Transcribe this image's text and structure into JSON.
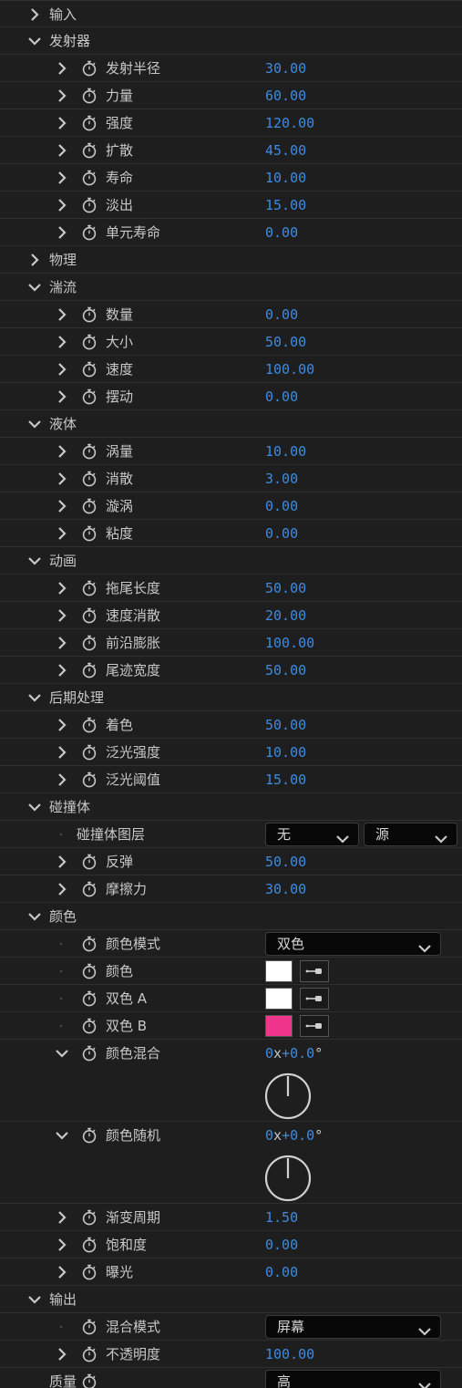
{
  "rows": [
    {
      "type": "group",
      "level": 0,
      "expanded": false,
      "label": "输入"
    },
    {
      "type": "group",
      "level": 0,
      "expanded": true,
      "label": "发射器"
    },
    {
      "type": "value",
      "level": 1,
      "twisty": true,
      "watch": true,
      "label": "发射半径",
      "value": "30.00"
    },
    {
      "type": "value",
      "level": 1,
      "twisty": true,
      "watch": true,
      "label": "力量",
      "value": "60.00"
    },
    {
      "type": "value",
      "level": 1,
      "twisty": true,
      "watch": true,
      "label": "强度",
      "value": "120.00"
    },
    {
      "type": "value",
      "level": 1,
      "twisty": true,
      "watch": true,
      "label": "扩散",
      "value": "45.00"
    },
    {
      "type": "value",
      "level": 1,
      "twisty": true,
      "watch": true,
      "label": "寿命",
      "value": "10.00"
    },
    {
      "type": "value",
      "level": 1,
      "twisty": true,
      "watch": true,
      "label": "淡出",
      "value": "15.00"
    },
    {
      "type": "value",
      "level": 1,
      "twisty": true,
      "watch": true,
      "label": "单元寿命",
      "value": "0.00"
    },
    {
      "type": "group",
      "level": 0,
      "expanded": false,
      "label": "物理"
    },
    {
      "type": "group",
      "level": 0,
      "expanded": true,
      "label": "湍流"
    },
    {
      "type": "value",
      "level": 1,
      "twisty": true,
      "watch": true,
      "label": "数量",
      "value": "0.00"
    },
    {
      "type": "value",
      "level": 1,
      "twisty": true,
      "watch": true,
      "label": "大小",
      "value": "50.00"
    },
    {
      "type": "value",
      "level": 1,
      "twisty": true,
      "watch": true,
      "label": "速度",
      "value": "100.00"
    },
    {
      "type": "value",
      "level": 1,
      "twisty": true,
      "watch": true,
      "label": "摆动",
      "value": "0.00"
    },
    {
      "type": "group",
      "level": 0,
      "expanded": true,
      "label": "液体"
    },
    {
      "type": "value",
      "level": 1,
      "twisty": true,
      "watch": true,
      "label": "涡量",
      "value": "10.00"
    },
    {
      "type": "value",
      "level": 1,
      "twisty": true,
      "watch": true,
      "label": "消散",
      "value": "3.00"
    },
    {
      "type": "value",
      "level": 1,
      "twisty": true,
      "watch": true,
      "label": "漩涡",
      "value": "0.00"
    },
    {
      "type": "value",
      "level": 1,
      "twisty": true,
      "watch": true,
      "label": "粘度",
      "value": "0.00"
    },
    {
      "type": "group",
      "level": 0,
      "expanded": true,
      "label": "动画"
    },
    {
      "type": "value",
      "level": 1,
      "twisty": true,
      "watch": true,
      "label": "拖尾长度",
      "value": "50.00"
    },
    {
      "type": "value",
      "level": 1,
      "twisty": true,
      "watch": true,
      "label": "速度消散",
      "value": "20.00"
    },
    {
      "type": "value",
      "level": 1,
      "twisty": true,
      "watch": true,
      "label": "前沿膨胀",
      "value": "100.00"
    },
    {
      "type": "value",
      "level": 1,
      "twisty": true,
      "watch": true,
      "label": "尾迹宽度",
      "value": "50.00"
    },
    {
      "type": "group",
      "level": 0,
      "expanded": true,
      "label": "后期处理"
    },
    {
      "type": "value",
      "level": 1,
      "twisty": true,
      "watch": true,
      "label": "着色",
      "value": "50.00"
    },
    {
      "type": "value",
      "level": 1,
      "twisty": true,
      "watch": true,
      "label": "泛光强度",
      "value": "10.00"
    },
    {
      "type": "value",
      "level": 1,
      "twisty": true,
      "watch": true,
      "label": "泛光阈值",
      "value": "15.00"
    },
    {
      "type": "group",
      "level": 0,
      "expanded": true,
      "label": "碰撞体"
    },
    {
      "type": "dual-select",
      "level": 1,
      "twisty": false,
      "watch": false,
      "label": "碰撞体图层",
      "select_a": "无",
      "select_b": "源"
    },
    {
      "type": "value",
      "level": 1,
      "twisty": true,
      "watch": true,
      "label": "反弹",
      "value": "50.00"
    },
    {
      "type": "value",
      "level": 1,
      "twisty": true,
      "watch": true,
      "label": "摩擦力",
      "value": "30.00"
    },
    {
      "type": "group",
      "level": 0,
      "expanded": true,
      "label": "颜色"
    },
    {
      "type": "select",
      "level": 1,
      "twisty": false,
      "watch": true,
      "label": "颜色模式",
      "select": "双色"
    },
    {
      "type": "color",
      "level": 1,
      "twisty": false,
      "watch": true,
      "label": "颜色",
      "color": "#ffffff"
    },
    {
      "type": "color",
      "level": 1,
      "twisty": false,
      "watch": true,
      "label": "双色 A",
      "color": "#ffffff"
    },
    {
      "type": "color",
      "level": 1,
      "twisty": false,
      "watch": true,
      "label": "双色 B",
      "color": "#f0358c"
    },
    {
      "type": "angle",
      "level": 1,
      "twisty": true,
      "expanded": true,
      "watch": true,
      "label": "颜色混合",
      "revolutions": "0",
      "x_sep": "x",
      "degrees": "+0.0",
      "degree_sign": "°",
      "angle_deg": 0
    },
    {
      "type": "angle",
      "level": 1,
      "twisty": true,
      "expanded": true,
      "watch": true,
      "label": "颜色随机",
      "revolutions": "0",
      "x_sep": "x",
      "degrees": "+0.0",
      "degree_sign": "°",
      "angle_deg": 0
    },
    {
      "type": "value",
      "level": 1,
      "twisty": true,
      "watch": true,
      "label": "渐变周期",
      "value": "1.50"
    },
    {
      "type": "value",
      "level": 1,
      "twisty": true,
      "watch": true,
      "label": "饱和度",
      "value": "0.00"
    },
    {
      "type": "value",
      "level": 1,
      "twisty": true,
      "watch": true,
      "label": "曝光",
      "value": "0.00"
    },
    {
      "type": "group",
      "level": 0,
      "expanded": true,
      "label": "输出"
    },
    {
      "type": "select",
      "level": 1,
      "twisty": false,
      "watch": true,
      "label": "混合模式",
      "select": "屏幕"
    },
    {
      "type": "value",
      "level": 1,
      "twisty": true,
      "watch": true,
      "label": "不透明度",
      "value": "100.00"
    },
    {
      "type": "select",
      "level": 0,
      "twisty": false,
      "watch": true,
      "label": "质量",
      "select": "高"
    }
  ],
  "colors": {
    "value_blue": "#3d8be2",
    "panel_bg": "#1e1e1e",
    "divider": "#2f2f2f",
    "text": "#c8c8c8"
  },
  "icons": {
    "expand": "chevron-right-icon",
    "collapse": "chevron-down-icon",
    "keyframe": "stopwatch-icon",
    "eyedropper": "eyedropper-icon",
    "dropdown": "chevron-down-icon",
    "angle": "angle-dial-icon"
  }
}
